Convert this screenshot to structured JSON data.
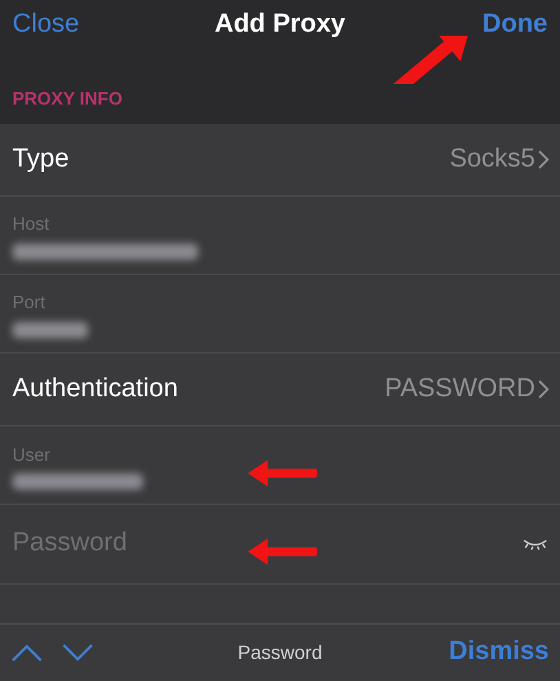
{
  "nav": {
    "left_button": "Close",
    "title": "Add Proxy",
    "right_button": "Done",
    "right_annotated": true
  },
  "section": {
    "header": "PROXY INFO"
  },
  "rows": [
    {
      "kind": "disclosure",
      "label": "Type",
      "value": "Socks5",
      "annotated": false
    },
    {
      "kind": "redacted",
      "label": "Host",
      "annotated": false
    },
    {
      "kind": "redacted",
      "label": "Port",
      "annotated": false
    },
    {
      "kind": "disclosure",
      "label": "Authentication",
      "value": "PASSWORD",
      "annotated": false
    },
    {
      "kind": "redacted",
      "label": "User",
      "annotated": true
    },
    {
      "kind": "secure",
      "placeholder": "Password",
      "annotated": true
    },
    {
      "kind": "cut"
    }
  ],
  "accessory_bar": {
    "field_name": "Password",
    "dismiss": "Dismiss"
  }
}
